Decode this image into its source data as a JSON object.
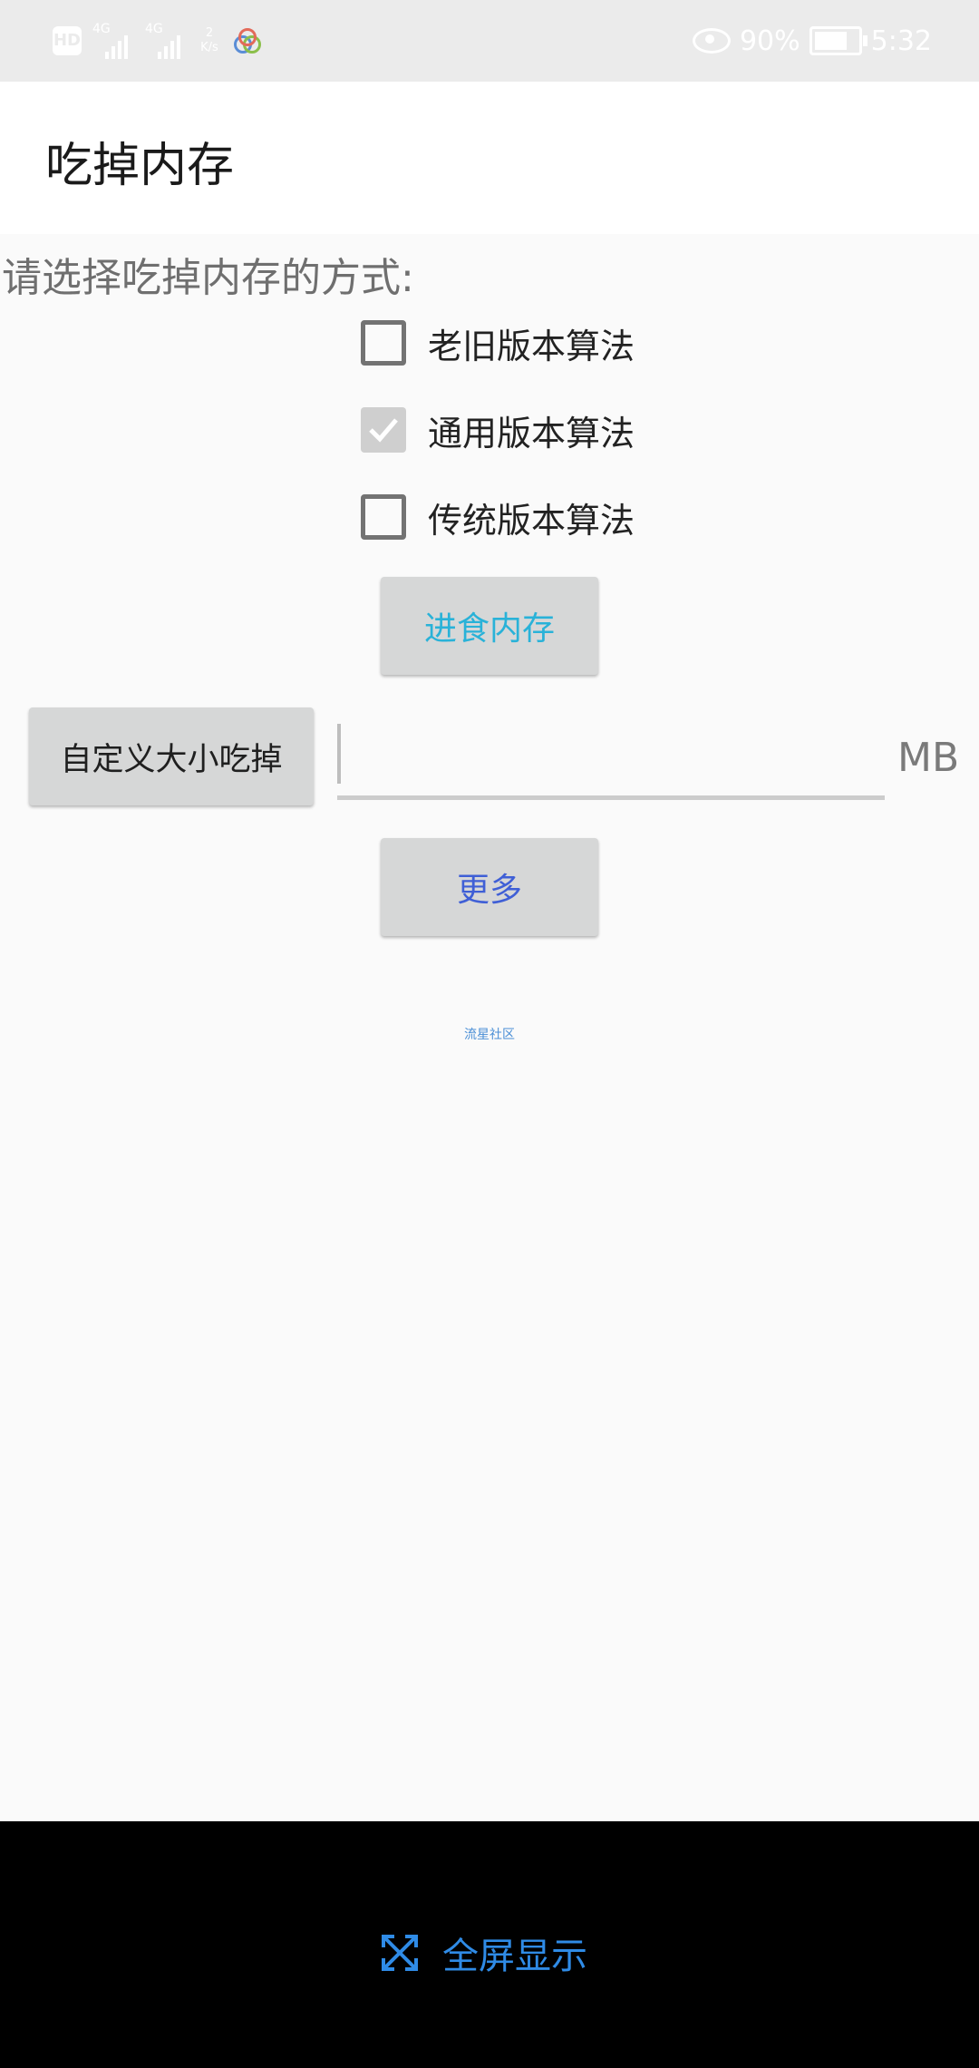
{
  "status_bar": {
    "left_icons": [
      "hd-icon",
      "signal-4g-icon",
      "signal-4g-icon",
      "net-speed",
      "app-notification-icon"
    ],
    "hd_label": "HD",
    "net1_label": "4G",
    "net2_label": "4G",
    "net_speed_value": "2",
    "net_speed_unit": "K/s",
    "battery_text": "90%",
    "battery_level": 0.9,
    "time": "5:32"
  },
  "app_bar": {
    "title": "吃掉内存"
  },
  "main": {
    "prompt": "请选择吃掉内存的方式:",
    "options": [
      {
        "label": "老旧版本算法",
        "checked": false
      },
      {
        "label": "通用版本算法",
        "checked": true
      },
      {
        "label": "传统版本算法",
        "checked": false
      }
    ],
    "eat_button": {
      "label": "进食内存",
      "color": "#29b2d8"
    },
    "custom_button": {
      "label": "自定义大小吃掉",
      "color": "#1f1f1f"
    },
    "size_input": {
      "value": "",
      "placeholder": ""
    },
    "unit_label": "MB",
    "more_button": {
      "label": "更多",
      "color": "#3f5fd6"
    },
    "footer_link": "流星社区"
  },
  "bottom_bar": {
    "fullscreen_label": "全屏显示",
    "accent": "#2f8be6"
  }
}
